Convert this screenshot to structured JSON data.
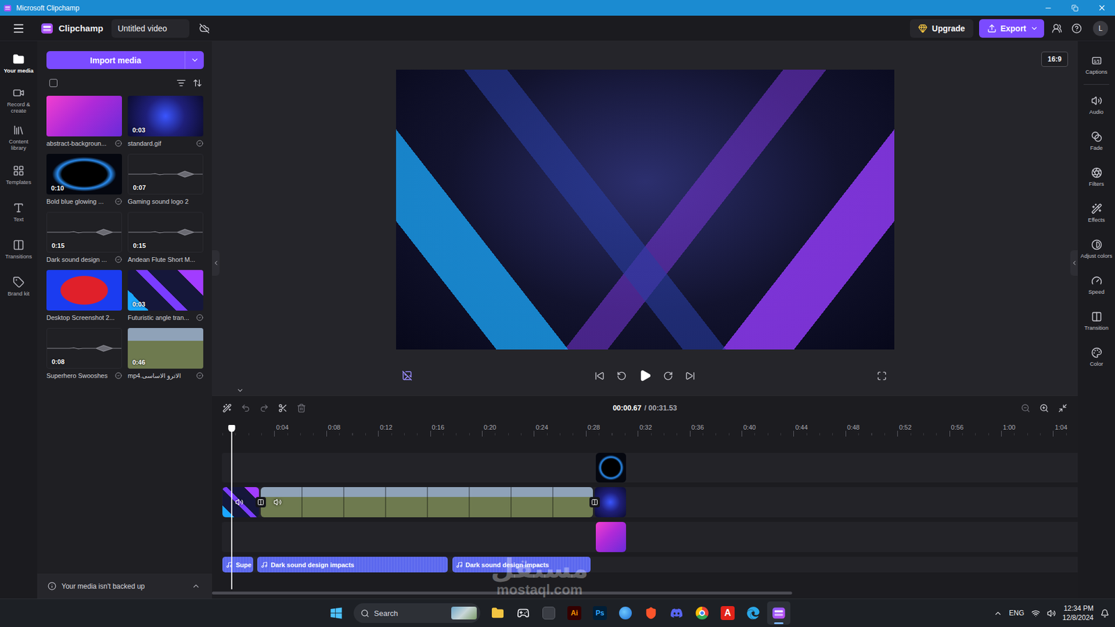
{
  "window": {
    "title": "Microsoft Clipchamp"
  },
  "header": {
    "app_name": "Clipchamp",
    "project_title": "Untitled video",
    "upgrade": "Upgrade",
    "export": "Export",
    "avatar": "L"
  },
  "rail": [
    {
      "label": "Your media",
      "selected": true
    },
    {
      "label": "Record & create",
      "selected": false
    },
    {
      "label": "Content library",
      "selected": false
    },
    {
      "label": "Templates",
      "selected": false
    },
    {
      "label": "Text",
      "selected": false
    },
    {
      "label": "Transitions",
      "selected": false
    },
    {
      "label": "Brand kit",
      "selected": false
    }
  ],
  "media": {
    "import_button": "Import media",
    "select_all": false,
    "items": [
      {
        "name": "abstract-backgroun...",
        "kind": "abstract",
        "added": true
      },
      {
        "name": "standard.gif",
        "duration": "0:03",
        "kind": "logo",
        "added": true
      },
      {
        "name": "Bold blue glowing ...",
        "duration": "0:10",
        "kind": "glow",
        "added": true
      },
      {
        "name": "Gaming sound logo 2",
        "duration": "0:07",
        "kind": "audio",
        "added": false
      },
      {
        "name": "Dark sound design ...",
        "duration": "0:15",
        "kind": "audio",
        "added": true
      },
      {
        "name": "Andean Flute Short M...",
        "duration": "0:15",
        "kind": "audio",
        "added": false
      },
      {
        "name": "Desktop Screenshot 2...",
        "kind": "screenshot",
        "added": false
      },
      {
        "name": "Futuristic angle tran...",
        "duration": "0:03",
        "kind": "angle",
        "added": true
      },
      {
        "name": "Superhero Swooshes",
        "duration": "0:08",
        "kind": "audio",
        "added": true
      },
      {
        "name": "الاترو الاساسى.mp4",
        "duration": "0:46",
        "kind": "gameplay",
        "added": true
      }
    ],
    "backup_notice": "Your media isn't backed up"
  },
  "preview": {
    "aspect_ratio": "16:9"
  },
  "timeline": {
    "current": "00:00.67",
    "total": "/ 00:31.53",
    "playhead": 0.67,
    "scroll_level": 0.67,
    "ticks": [
      "0:04",
      "0:08",
      "0:12",
      "0:16",
      "0:20",
      "0:24",
      "0:28",
      "0:32",
      "0:36",
      "0:40",
      "0:44",
      "0:48",
      "0:52",
      "0:56",
      "1:00",
      "1:04"
    ],
    "tracks": [
      {
        "kind": "overlay",
        "clips": [
          {
            "kind": "glow",
            "start": 28.77,
            "end": 31.23
          }
        ]
      },
      {
        "kind": "main",
        "transitions": [
          2.96,
          28.66
        ],
        "clips": [
          {
            "kind": "angle",
            "start": 0,
            "end": 2.96,
            "audio": true
          },
          {
            "kind": "gameplay",
            "start": 2.96,
            "end": 28.66,
            "audio": true
          },
          {
            "kind": "logo",
            "start": 28.66,
            "end": 31.23,
            "audio": false
          }
        ]
      },
      {
        "kind": "image",
        "clips": [
          {
            "kind": "abstract",
            "start": 28.77,
            "end": 31.23
          }
        ]
      },
      {
        "kind": "audio",
        "clips": [
          {
            "label": "Supe",
            "start": 0,
            "end": 2.5
          },
          {
            "label": "Dark sound design impacts",
            "start": 2.7,
            "end": 17.5
          },
          {
            "label": "Dark sound design impacts",
            "start": 17.7,
            "end": 28.5
          }
        ]
      }
    ]
  },
  "tools": [
    "Captions",
    "Audio",
    "Fade",
    "Filters",
    "Effects",
    "Adjust colors",
    "Speed",
    "Transition",
    "Color"
  ],
  "taskbar": {
    "search": "Search",
    "apps": [
      {
        "kind": "explorer",
        "selected": false
      },
      {
        "kind": "games",
        "selected": false
      },
      {
        "kind": "app",
        "selected": false
      },
      {
        "kind": "illustrator",
        "label": "Ai",
        "selected": false
      },
      {
        "kind": "photoshop",
        "label": "Ps",
        "selected": false
      },
      {
        "kind": "vpn",
        "selected": false
      },
      {
        "kind": "brave",
        "selected": false
      },
      {
        "kind": "discord",
        "selected": false
      },
      {
        "kind": "chrome",
        "selected": false
      },
      {
        "kind": "acrobat",
        "label": "A",
        "selected": false
      },
      {
        "kind": "edge",
        "selected": false
      },
      {
        "kind": "clipchamp",
        "selected": true
      }
    ],
    "language": "ENG",
    "time": "12:34 PM",
    "date": "12/8/2024"
  },
  "watermark": {
    "name": "مستقل",
    "site": "mostaql.com"
  }
}
